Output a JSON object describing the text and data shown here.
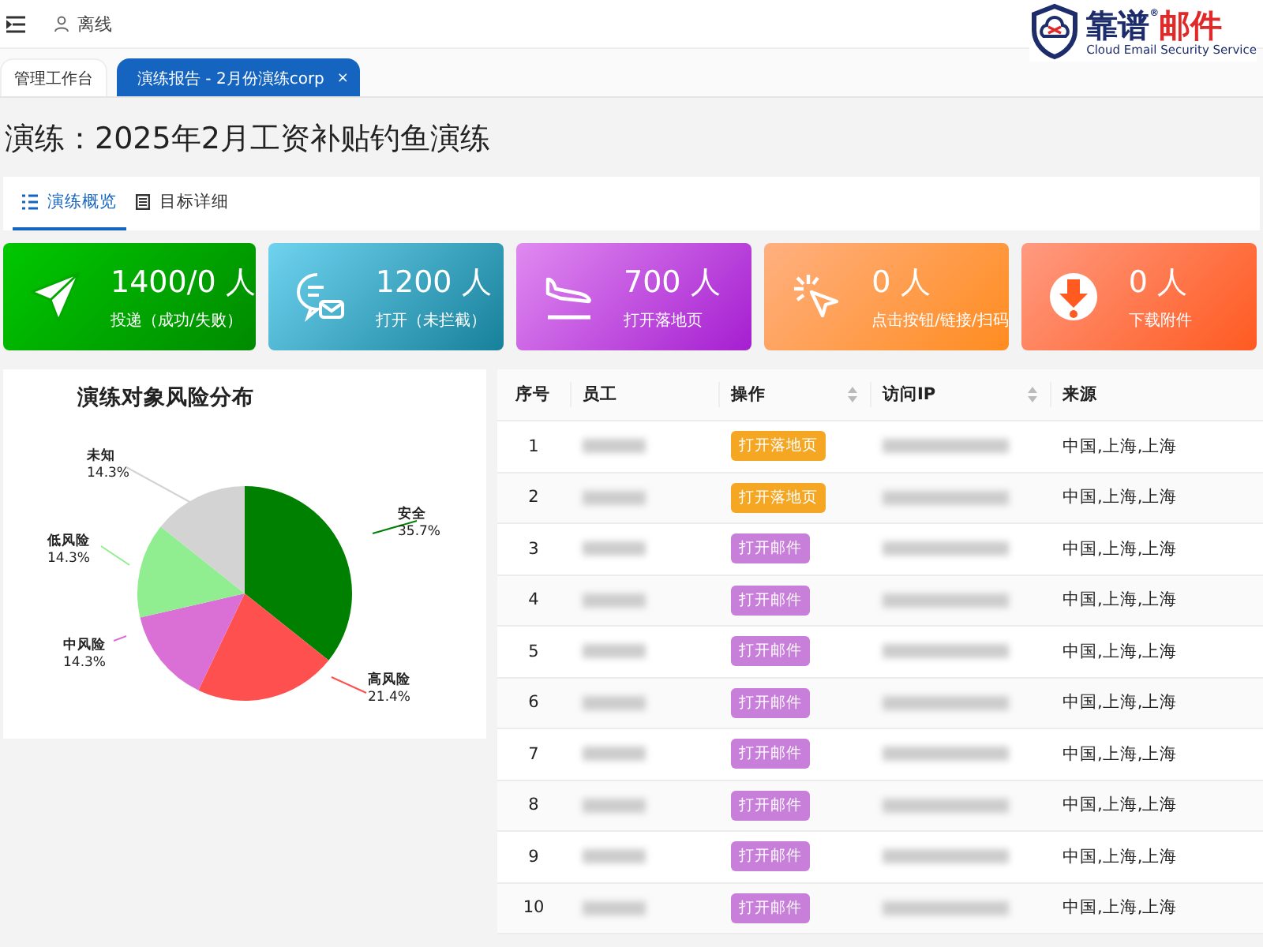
{
  "topbar": {
    "status": "离线"
  },
  "brand": {
    "name": "靠谱",
    "mark": "®",
    "product": "邮件",
    "tagline": "Cloud Email Security Service"
  },
  "tabs": [
    {
      "label": "管理工作台",
      "selected": false,
      "closable": false
    },
    {
      "label": "演练报告 - 2月份演练corp",
      "selected": true,
      "closable": true,
      "close": "×"
    }
  ],
  "title": "演练：2025年2月工资补贴钓鱼演练",
  "subtabs": [
    {
      "label": "演练概览",
      "selected": true,
      "kind": "grid"
    },
    {
      "label": "目标详细",
      "selected": false,
      "kind": "doc"
    }
  ],
  "stats": [
    {
      "kind": "send",
      "value": "1400/0 人",
      "label": "投递（成功/失败）"
    },
    {
      "kind": "open",
      "value": "1200 人",
      "label": "打开（未拦截）"
    },
    {
      "kind": "landing",
      "value": "700 人",
      "label": "打开落地页"
    },
    {
      "kind": "click",
      "value": "0 人",
      "label": "点击按钮/链接/扫码"
    },
    {
      "kind": "download",
      "value": "0 人",
      "label": "下载附件"
    }
  ],
  "risk_chart": {
    "chart_data": {
      "type": "pie",
      "title": "演练对象风险分布",
      "categories": [
        "安全",
        "高风险",
        "中风险",
        "低风险",
        "未知"
      ],
      "series": [
        {
          "values": [
            35.7,
            21.4,
            14.3,
            14.3,
            14.3
          ],
          "colors": [
            "#008000",
            "#ff5050",
            "#da70d6",
            "#90ee90",
            "#d3d3d3"
          ]
        }
      ],
      "value_labels": [
        "35.7%",
        "21.4%",
        "14.3%",
        "14.3%",
        "14.3%"
      ]
    }
  },
  "table": {
    "columns": [
      {
        "label": "序号",
        "sortable": false
      },
      {
        "label": "员工",
        "sortable": false
      },
      {
        "label": "操作",
        "sortable": true
      },
      {
        "label": "访问IP",
        "sortable": true
      },
      {
        "label": "来源",
        "sortable": false
      }
    ],
    "rows": [
      {
        "index": "1",
        "action": {
          "kind": "landing",
          "label": "打开落地页"
        },
        "source": "中国,上海,上海"
      },
      {
        "index": "2",
        "action": {
          "kind": "landing",
          "label": "打开落地页"
        },
        "source": "中国,上海,上海"
      },
      {
        "index": "3",
        "action": {
          "kind": "mail",
          "label": "打开邮件"
        },
        "source": "中国,上海,上海"
      },
      {
        "index": "4",
        "action": {
          "kind": "mail",
          "label": "打开邮件"
        },
        "source": "中国,上海,上海"
      },
      {
        "index": "5",
        "action": {
          "kind": "mail",
          "label": "打开邮件"
        },
        "source": "中国,上海,上海"
      },
      {
        "index": "6",
        "action": {
          "kind": "mail",
          "label": "打开邮件"
        },
        "source": "中国,上海,上海"
      },
      {
        "index": "7",
        "action": {
          "kind": "mail",
          "label": "打开邮件"
        },
        "source": "中国,上海,上海"
      },
      {
        "index": "8",
        "action": {
          "kind": "mail",
          "label": "打开邮件"
        },
        "source": "中国,上海,上海"
      },
      {
        "index": "9",
        "action": {
          "kind": "mail",
          "label": "打开邮件"
        },
        "source": "中国,上海,上海"
      },
      {
        "index": "10",
        "action": {
          "kind": "mail",
          "label": "打开邮件"
        },
        "source": "中国,上海,上海"
      }
    ]
  }
}
